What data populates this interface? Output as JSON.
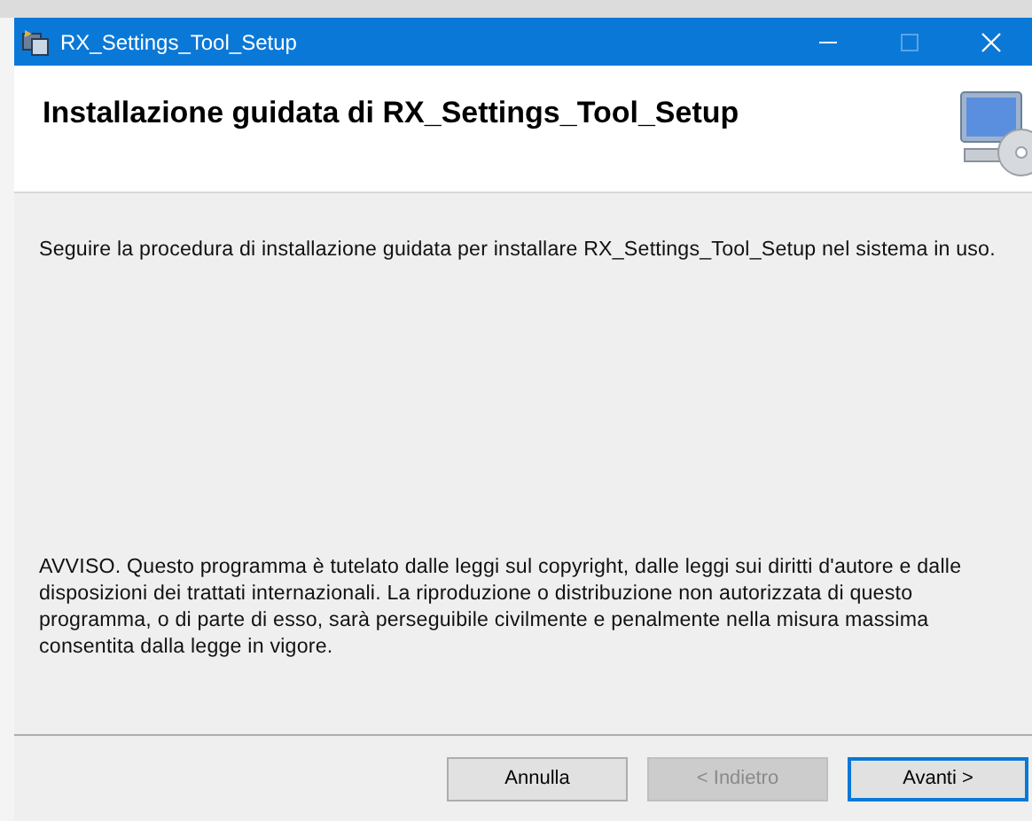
{
  "window": {
    "title": "RX_Settings_Tool_Setup"
  },
  "window_controls": [
    {
      "kind": "minimize",
      "disabled": false
    },
    {
      "kind": "maximize",
      "disabled": true
    },
    {
      "kind": "close",
      "disabled": false
    }
  ],
  "header": {
    "title": "Installazione guidata di RX_Settings_Tool_Setup"
  },
  "intro": "Seguire la procedura di installazione guidata per installare RX_Settings_Tool_Setup nel sistema in uso.",
  "notice": "AVVISO. Questo programma è tutelato dalle leggi sul copyright, dalle leggi sui diritti d'autore e dalle disposizioni dei trattati internazionali. La riproduzione o distribuzione non autorizzata di questo programma, o di parte di esso, sarà perseguibile civilmente e penalmente nella misura massima consentita dalla legge in vigore.",
  "buttons": [
    {
      "label": "Annulla",
      "disabled": false,
      "default": false
    },
    {
      "label": "< Indietro",
      "disabled": true,
      "default": false
    },
    {
      "label": "Avanti >",
      "disabled": false,
      "default": true
    }
  ]
}
